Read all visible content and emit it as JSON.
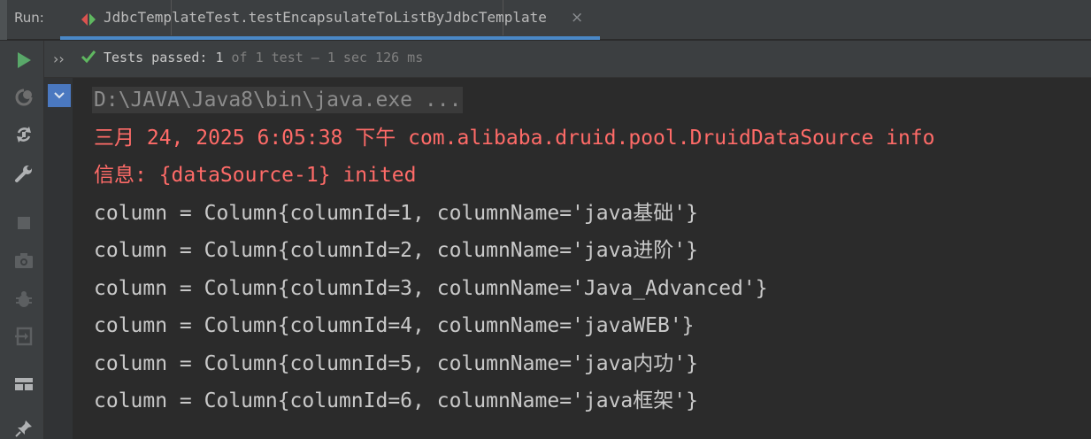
{
  "tabbar": {
    "run_label": "Run:",
    "tab_title": "JdbcTemplateTest.testEncapsulateToListByJdbcTemplate",
    "close_glyph": "×"
  },
  "status": {
    "chevron": "››",
    "passed_label": "Tests passed:",
    "passed_count": "1",
    "meta": "of 1 test – 1 sec 126 ms"
  },
  "toolbar": {
    "icons": [
      "run-icon",
      "rerun-failed-icon",
      "rerun-icon",
      "settings-wrench-icon",
      "stop-icon",
      "camera-icon",
      "debug-icon",
      "exit-icon",
      "layout-icon",
      "pin-icon"
    ]
  },
  "console": {
    "lines": [
      "D:\\JAVA\\Java8\\bin\\java.exe ...",
      "三月 24, 2025 6:05:38 下午 com.alibaba.druid.pool.DruidDataSource info",
      "信息: {dataSource-1} inited",
      "column = Column{columnId=1, columnName='java基础'}",
      "column = Column{columnId=2, columnName='java进阶'}",
      "column = Column{columnId=3, columnName='Java_Advanced'}",
      "column = Column{columnId=4, columnName='javaWEB'}",
      "column = Column{columnId=5, columnName='java内功'}",
      "column = Column{columnId=6, columnName='java框架'}"
    ]
  },
  "colors": {
    "accent": "#4a88c7",
    "passed_check": "#5fb760",
    "error_text": "#ff6b68"
  }
}
